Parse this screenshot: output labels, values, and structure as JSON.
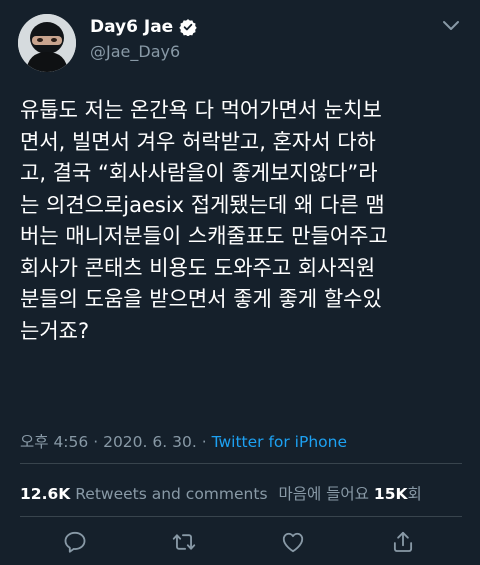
{
  "user": {
    "display_name": "Day6 Jae",
    "handle": "@Jae_Day6",
    "verified": true
  },
  "tweet": {
    "lines": [
      "유툽도 저는 온간욕 다 먹어가면서 눈치보",
      "면서, 빌면서 겨우 허락받고, 혼자서 다하",
      "고, 결국 “회사사람을이 좋게보지않다”라",
      "는 의견으로jaesix 접게됐는데 왜 다른 맴",
      "버는 매니저분들이 스캐줄표도 만들어주고",
      "회사가 콘태츠 비용도 도와주고 회사직원",
      "분들의 도움을 받으면서 좋게 좋게 할수있",
      "는거죠?"
    ]
  },
  "meta": {
    "time": "오후 4:56",
    "separator": "·",
    "date": "2020. 6. 30.",
    "source": "Twitter for iPhone"
  },
  "stats": {
    "retweets_count": "12.6K",
    "retweets_label": "Retweets and comments",
    "likes_label": "마음에 들어요",
    "likes_count": "15K",
    "likes_suffix": "회"
  },
  "actions": {
    "reply_icon": "reply-icon",
    "retweet_icon": "retweet-icon",
    "like_icon": "like-icon",
    "share_icon": "share-icon"
  },
  "colors": {
    "background": "#15202b",
    "text": "#ffffff",
    "secondary": "#8899a6",
    "link": "#1da1f2",
    "divider": "#38444d"
  }
}
